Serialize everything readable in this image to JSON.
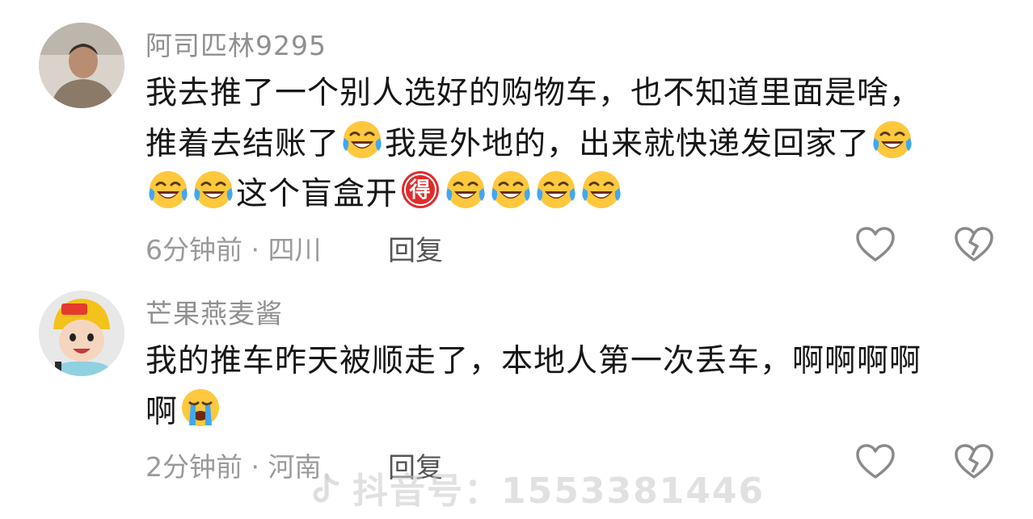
{
  "comments": [
    {
      "username": "阿司匹林9295",
      "lines": [
        [
          "我去推了一个别人选好的购物车，也不知道里面是啥，"
        ],
        [
          "推着去结账了",
          "@laugh-cry",
          "我是外地的，出来就快递发回家了",
          "@laugh-cry"
        ],
        [
          "@laugh-cry",
          "@laugh-cry",
          "这个盲盒开",
          "@de-badge",
          "@laugh-cry",
          "@laugh-cry",
          "@laugh-cry",
          "@laugh-cry"
        ]
      ],
      "time": "6分钟前",
      "location": "四川",
      "reply_label": "回复"
    },
    {
      "username": "芒果燕麦酱",
      "lines": [
        [
          "我的推车昨天被顺走了，本地人第一次丢车，啊啊啊啊"
        ],
        [
          "啊",
          "@crying"
        ]
      ],
      "time": "2分钟前",
      "location": "河南",
      "reply_label": "回复"
    }
  ],
  "meta_separator": " · ",
  "badge_char": "得",
  "watermark": {
    "text": "抖音号：1553381446",
    "icon": "douyin-logo-icon"
  },
  "icons": {
    "laugh-cry": "face-with-tears-of-joy-icon",
    "crying": "loudly-crying-face-icon",
    "de-badge": "de-red-badge-icon",
    "like": "heart-outline-icon",
    "dislike": "broken-heart-outline-icon"
  },
  "colors": {
    "username": "#8f8f8f",
    "text": "#161616",
    "meta": "#9a9a9a",
    "badge": "#e02b2b",
    "emoji": "#ffc83d"
  }
}
